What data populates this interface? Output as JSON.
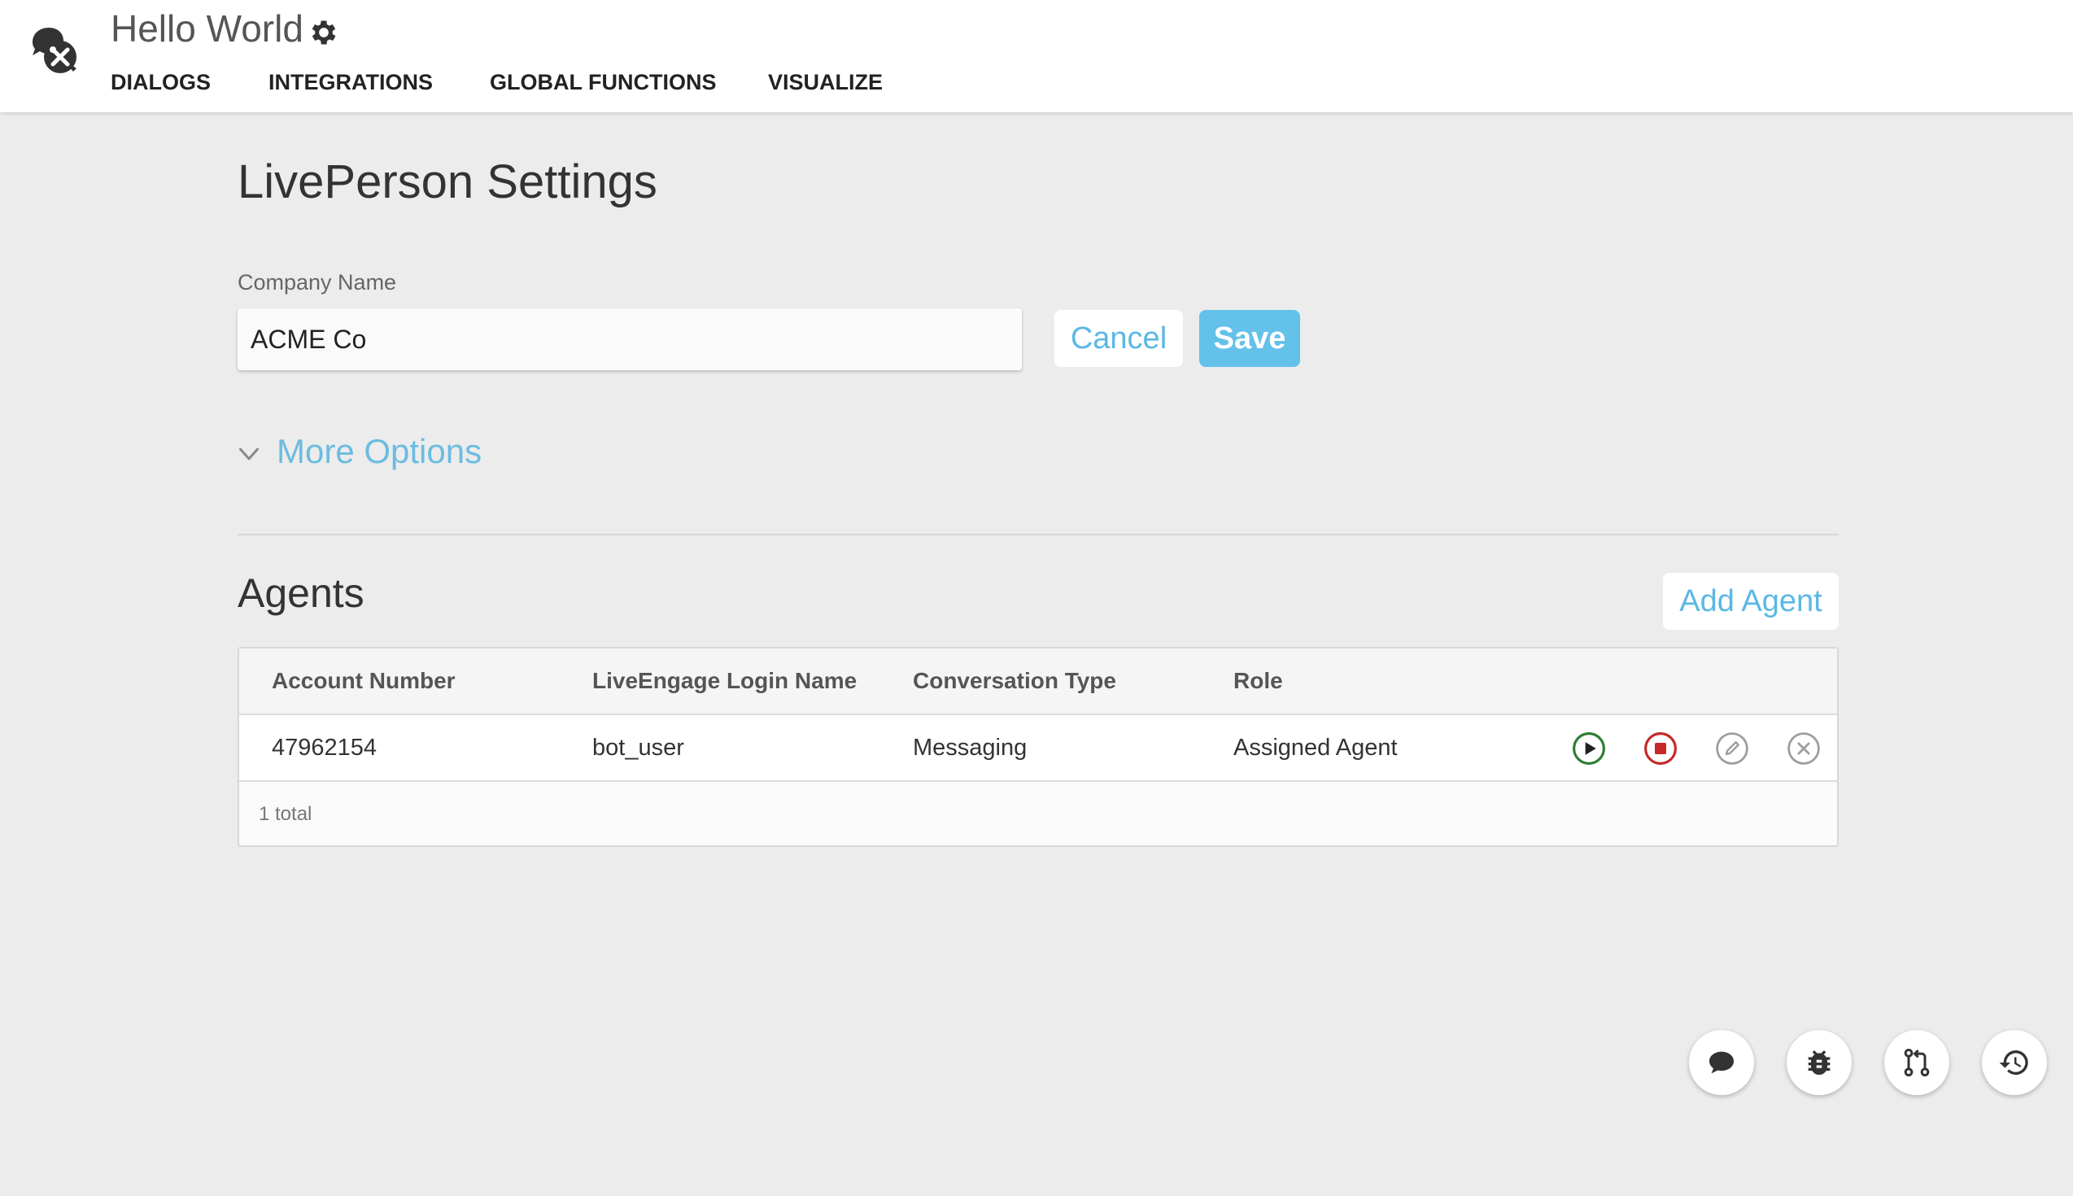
{
  "header": {
    "app_title": "Hello World",
    "logo_icon": "chat-tools-icon",
    "settings_icon": "gear-icon",
    "nav": [
      {
        "label": "DIALOGS"
      },
      {
        "label": "INTEGRATIONS"
      },
      {
        "label": "GLOBAL FUNCTIONS"
      },
      {
        "label": "VISUALIZE"
      }
    ]
  },
  "main": {
    "page_title": "LivePerson Settings",
    "company_field": {
      "label": "Company Name",
      "value": "ACME Co",
      "placeholder": ""
    },
    "cancel_label": "Cancel",
    "save_label": "Save",
    "more_options_label": "More Options",
    "agents": {
      "title": "Agents",
      "add_label": "Add Agent",
      "columns": [
        "Account Number",
        "LiveEngage Login Name",
        "Conversation Type",
        "Role"
      ],
      "rows": [
        {
          "account_number": "47962154",
          "login_name": "bot_user",
          "conversation_type": "Messaging",
          "role": "Assigned Agent",
          "actions": [
            "play-icon",
            "stop-icon",
            "edit-icon",
            "delete-icon"
          ]
        }
      ],
      "footer": "1 total"
    }
  },
  "fabs": [
    "chat-icon",
    "bug-icon",
    "pull-request-icon",
    "history-icon"
  ],
  "colors": {
    "accent": "#5bb8e4",
    "save_bg": "#63c1ea",
    "play": "#2e7d32",
    "stop": "#c62828",
    "muted_icon": "#9e9e9e",
    "background": "#ececec"
  }
}
